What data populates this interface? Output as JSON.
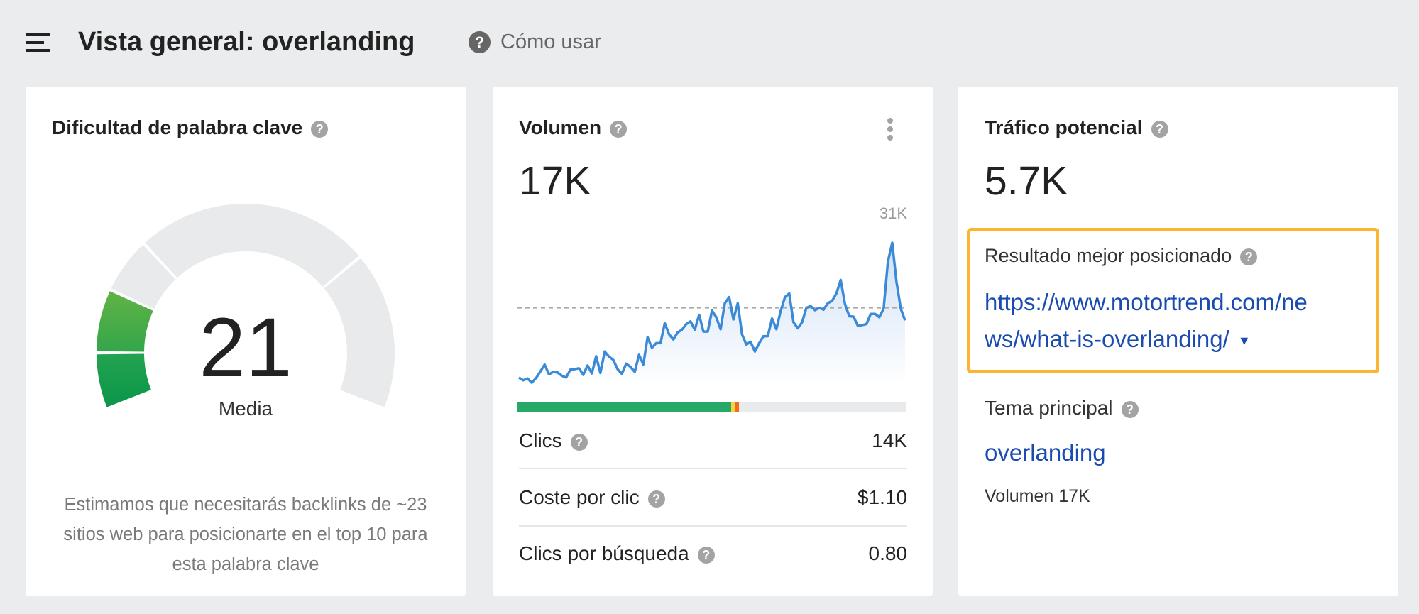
{
  "header": {
    "title": "Vista general: overlanding",
    "help_label": "Cómo usar"
  },
  "kd": {
    "title": "Dificultad de palabra clave",
    "score": "21",
    "score_value": 21,
    "level": "Media",
    "description": "Estimamos que necesitarás backlinks de ~23 sitios web para posicionarte en el top 10 para esta palabra clave"
  },
  "volume": {
    "title": "Volumen",
    "value": "17K",
    "max_label": "31K",
    "metrics": [
      {
        "label": "Clics",
        "value": "14K"
      },
      {
        "label": "Coste por clic",
        "value": "$1.10"
      },
      {
        "label": "Clics por búsqueda",
        "value": "0.80"
      }
    ],
    "click_bar": {
      "organic_pct": 55,
      "paid_pct": 2.3
    }
  },
  "traffic": {
    "title": "Tráfico potencial",
    "value": "5.7K",
    "top_result_label": "Resultado mejor posicionado",
    "top_result_url_1": "https://www.motortrend.com/ne",
    "top_result_url_2": "ws/what-is-overlanding/",
    "parent_topic_label": "Tema principal",
    "parent_topic": "overlanding",
    "parent_volume": "Volumen 17K"
  },
  "colors": {
    "accent_link": "#1a4bb0",
    "highlight": "#fbb52f",
    "line": "#3b8ad8",
    "green": "#27a866"
  },
  "chart_data": {
    "type": "area",
    "title": "Volumen",
    "ylim": [
      0,
      31
    ],
    "y_unit": "K",
    "max_label": "31K",
    "average": 17,
    "values": [
      2.0,
      1.4,
      1.8,
      0.9,
      1.9,
      3.3,
      4.8,
      2.7,
      3.2,
      3.1,
      2.4,
      2.0,
      3.7,
      3.8,
      4.0,
      2.6,
      4.6,
      2.9,
      6.6,
      3.0,
      7.6,
      6.5,
      5.8,
      3.8,
      2.8,
      5.0,
      4.3,
      3.2,
      6.9,
      4.8,
      10.7,
      8.4,
      9.4,
      9.4,
      13.7,
      11.3,
      10.2,
      11.7,
      12.3,
      13.5,
      14.1,
      12.3,
      15.5,
      11.9,
      11.9,
      16.4,
      15.0,
      12.4,
      18.0,
      19.3,
      14.5,
      18.0,
      11.3,
      9.1,
      9.7,
      7.6,
      9.4,
      10.9,
      10.9,
      14.7,
      12.4,
      16.3,
      19.3,
      20.1,
      13.9,
      12.6,
      13.9,
      17.0,
      17.4,
      16.5,
      17.0,
      16.6,
      18.0,
      18.5,
      20.1,
      23.0,
      17.8,
      15.2,
      15.1,
      13.1,
      13.3,
      13.5,
      15.7,
      15.7,
      15.0,
      16.8,
      26.9,
      31.0,
      22.6,
      16.8,
      14.3
    ]
  }
}
